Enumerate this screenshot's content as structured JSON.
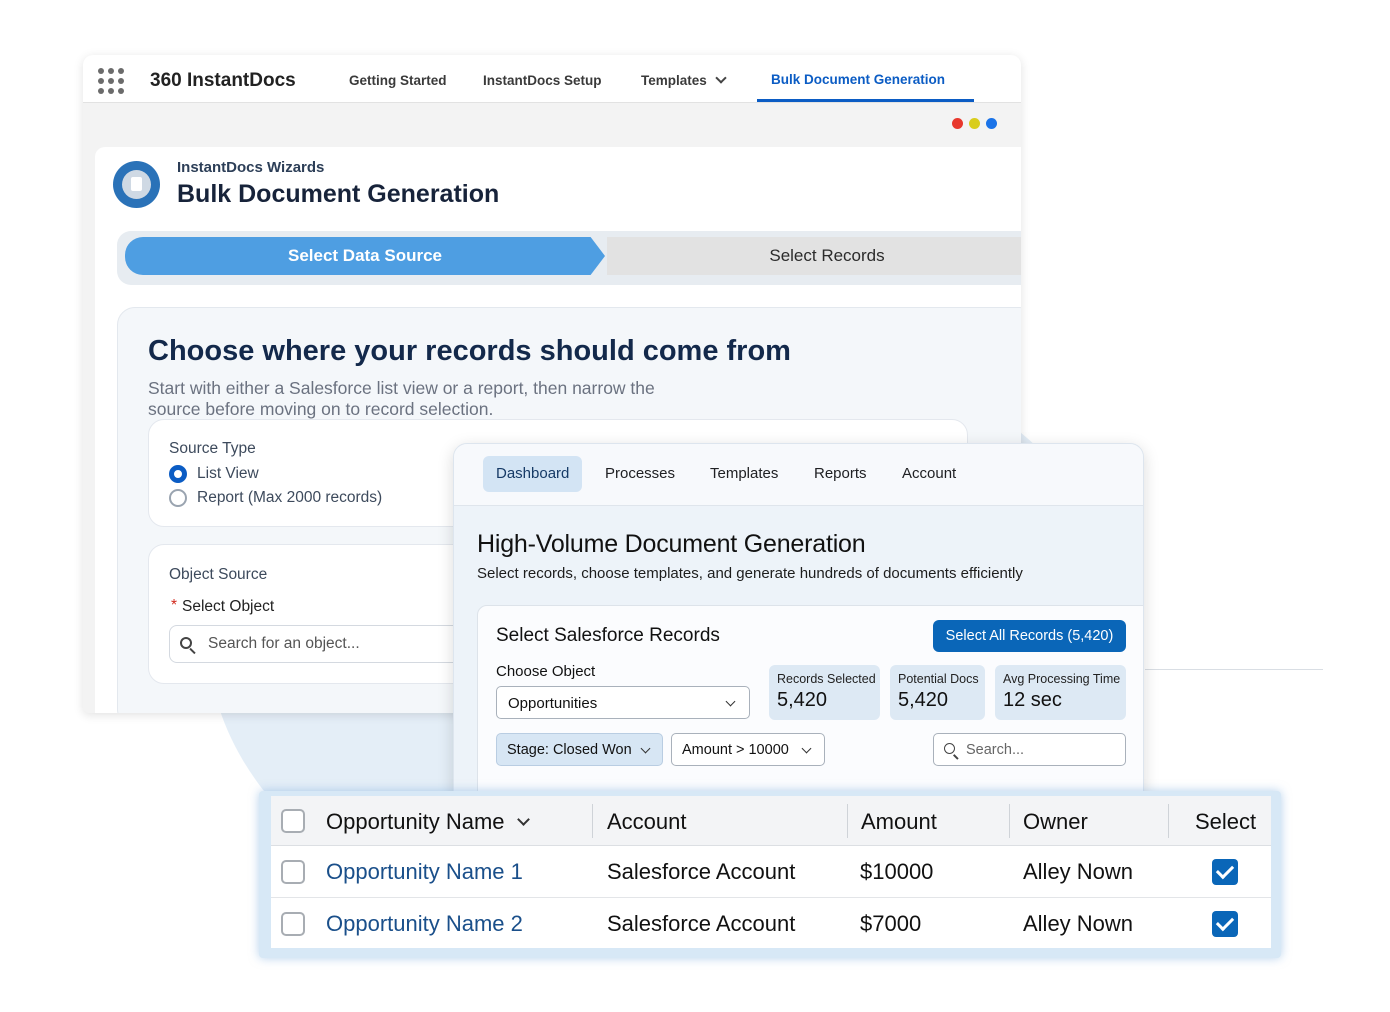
{
  "app": {
    "name": "360 InstantDocs",
    "nav": [
      "Getting Started",
      "InstantDocs Setup",
      "Templates",
      "Bulk Document Generation"
    ],
    "dots_colors": [
      "#e8372c",
      "#d9cd1c",
      "#1a73e8"
    ]
  },
  "wizard": {
    "subtitle": "InstantDocs Wizards",
    "title": "Bulk Document Generation",
    "steps": [
      "Select Data Source",
      "Select Records"
    ],
    "heading": "Choose where your records should come from",
    "description": "Start with either a Salesforce list view or a report, then narrow the source before moving on to record selection.",
    "source_type": {
      "label": "Source Type",
      "options": [
        "List View",
        "Report (Max 2000 records)"
      ],
      "selected": "List View"
    },
    "object_source": {
      "label": "Object Source",
      "required_mark": "*",
      "field_label": "Select Object",
      "placeholder": "Search for an object..."
    }
  },
  "dashboard": {
    "tabs": [
      "Dashboard",
      "Processes",
      "Templates",
      "Reports",
      "Account"
    ],
    "active_tab": "Dashboard",
    "title": "High-Volume Document Generation",
    "subtitle": "Select records, choose templates, and generate hundreds of documents efficiently",
    "card": {
      "title": "Select Salesforce Records",
      "select_all_button": "Select All Records (5,420)",
      "choose_object_label": "Choose Object",
      "choose_object_value": "Opportunities",
      "stats": [
        {
          "label": "Records Selected",
          "value": "5,420"
        },
        {
          "label": "Potential Docs",
          "value": "5,420"
        },
        {
          "label": "Avg Processing Time",
          "value": "12 sec"
        }
      ],
      "filters": [
        "Stage: Closed Won",
        "Amount > 10000"
      ],
      "search_placeholder": "Search..."
    }
  },
  "table": {
    "columns": [
      "Opportunity Name",
      "Account",
      "Amount",
      "Owner",
      "Select"
    ],
    "rows": [
      {
        "name": "Opportunity Name 1",
        "account": "Salesforce Account",
        "amount": "$10000",
        "owner": "Alley Nown",
        "selected": true
      },
      {
        "name": "Opportunity Name 2",
        "account": "Salesforce Account",
        "amount": "$7000",
        "owner": "Alley Nown",
        "selected": true
      }
    ]
  }
}
